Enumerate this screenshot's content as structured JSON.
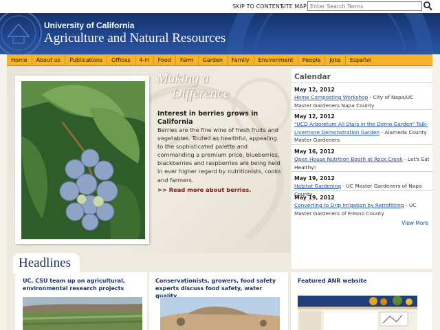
{
  "utility": {
    "skip_label": "SKIP TO CONTENT",
    "sitemap_label": "SITE MAP",
    "search_placeholder": "Enter Search Terms"
  },
  "banner": {
    "university": "University of California",
    "title": "Agriculture and Natural Resources"
  },
  "nav": [
    "Home",
    "About us",
    "Publications",
    "Offices",
    "4-H",
    "Food",
    "Farm",
    "Garden",
    "Family",
    "Environment",
    "People",
    "Jobs",
    "Español"
  ],
  "feature": {
    "heading_line1": "Making a",
    "heading_line2": "Difference",
    "title": "Interest in berries grows in California",
    "body": "Berries are the fine wine of fresh fruits and vegetables. Touted as healthful, appealing to the sophisticated palette and commanding a premium price, blueberries, blackberries and raspberries are being held in ever higher regard by nutritionists, cooks and farmers.",
    "more": ">> Read more about berries."
  },
  "calendar": {
    "title": "Calendar",
    "events": [
      {
        "date": "May 12, 2012",
        "link": "Home Composting Workshop",
        "rest": " - City of Napa/UC Master Gardeners Napa County"
      },
      {
        "date": "May 12, 2012",
        "link": "\"UCD Arboretum All Stars in the Demo Garden\" Talk- Livermore Demonstration Garden",
        "rest": " - Alameda County Master Gardeners"
      },
      {
        "date": "May 16, 2012",
        "link": "Open House Nutrition Booth at Rock Creek",
        "rest": " - Let's Eat Healthy!"
      },
      {
        "date": "May 19, 2012",
        "link": "Habitat Gardening",
        "rest": " - UC Master Gardeners of Napa County"
      },
      {
        "date": "May 19, 2012",
        "link": "Converting to Drip Irrigation by Retrofitting",
        "rest": " - UC Master Gardeners of Fresno County"
      }
    ],
    "view_more": "View More"
  },
  "headlines": {
    "label": "Headlines",
    "items": [
      {
        "title": "UC, CSU team up on agricultural, environmental research projects"
      },
      {
        "title": "Conservationists, growers, food safety experts discuss food safety, water quality"
      },
      {
        "title": "Featured ANR website"
      }
    ]
  },
  "colors": {
    "banner": "#1f4790",
    "nav": "#f7b32b",
    "link": "#1a4d9b",
    "headline": "#16326d"
  }
}
